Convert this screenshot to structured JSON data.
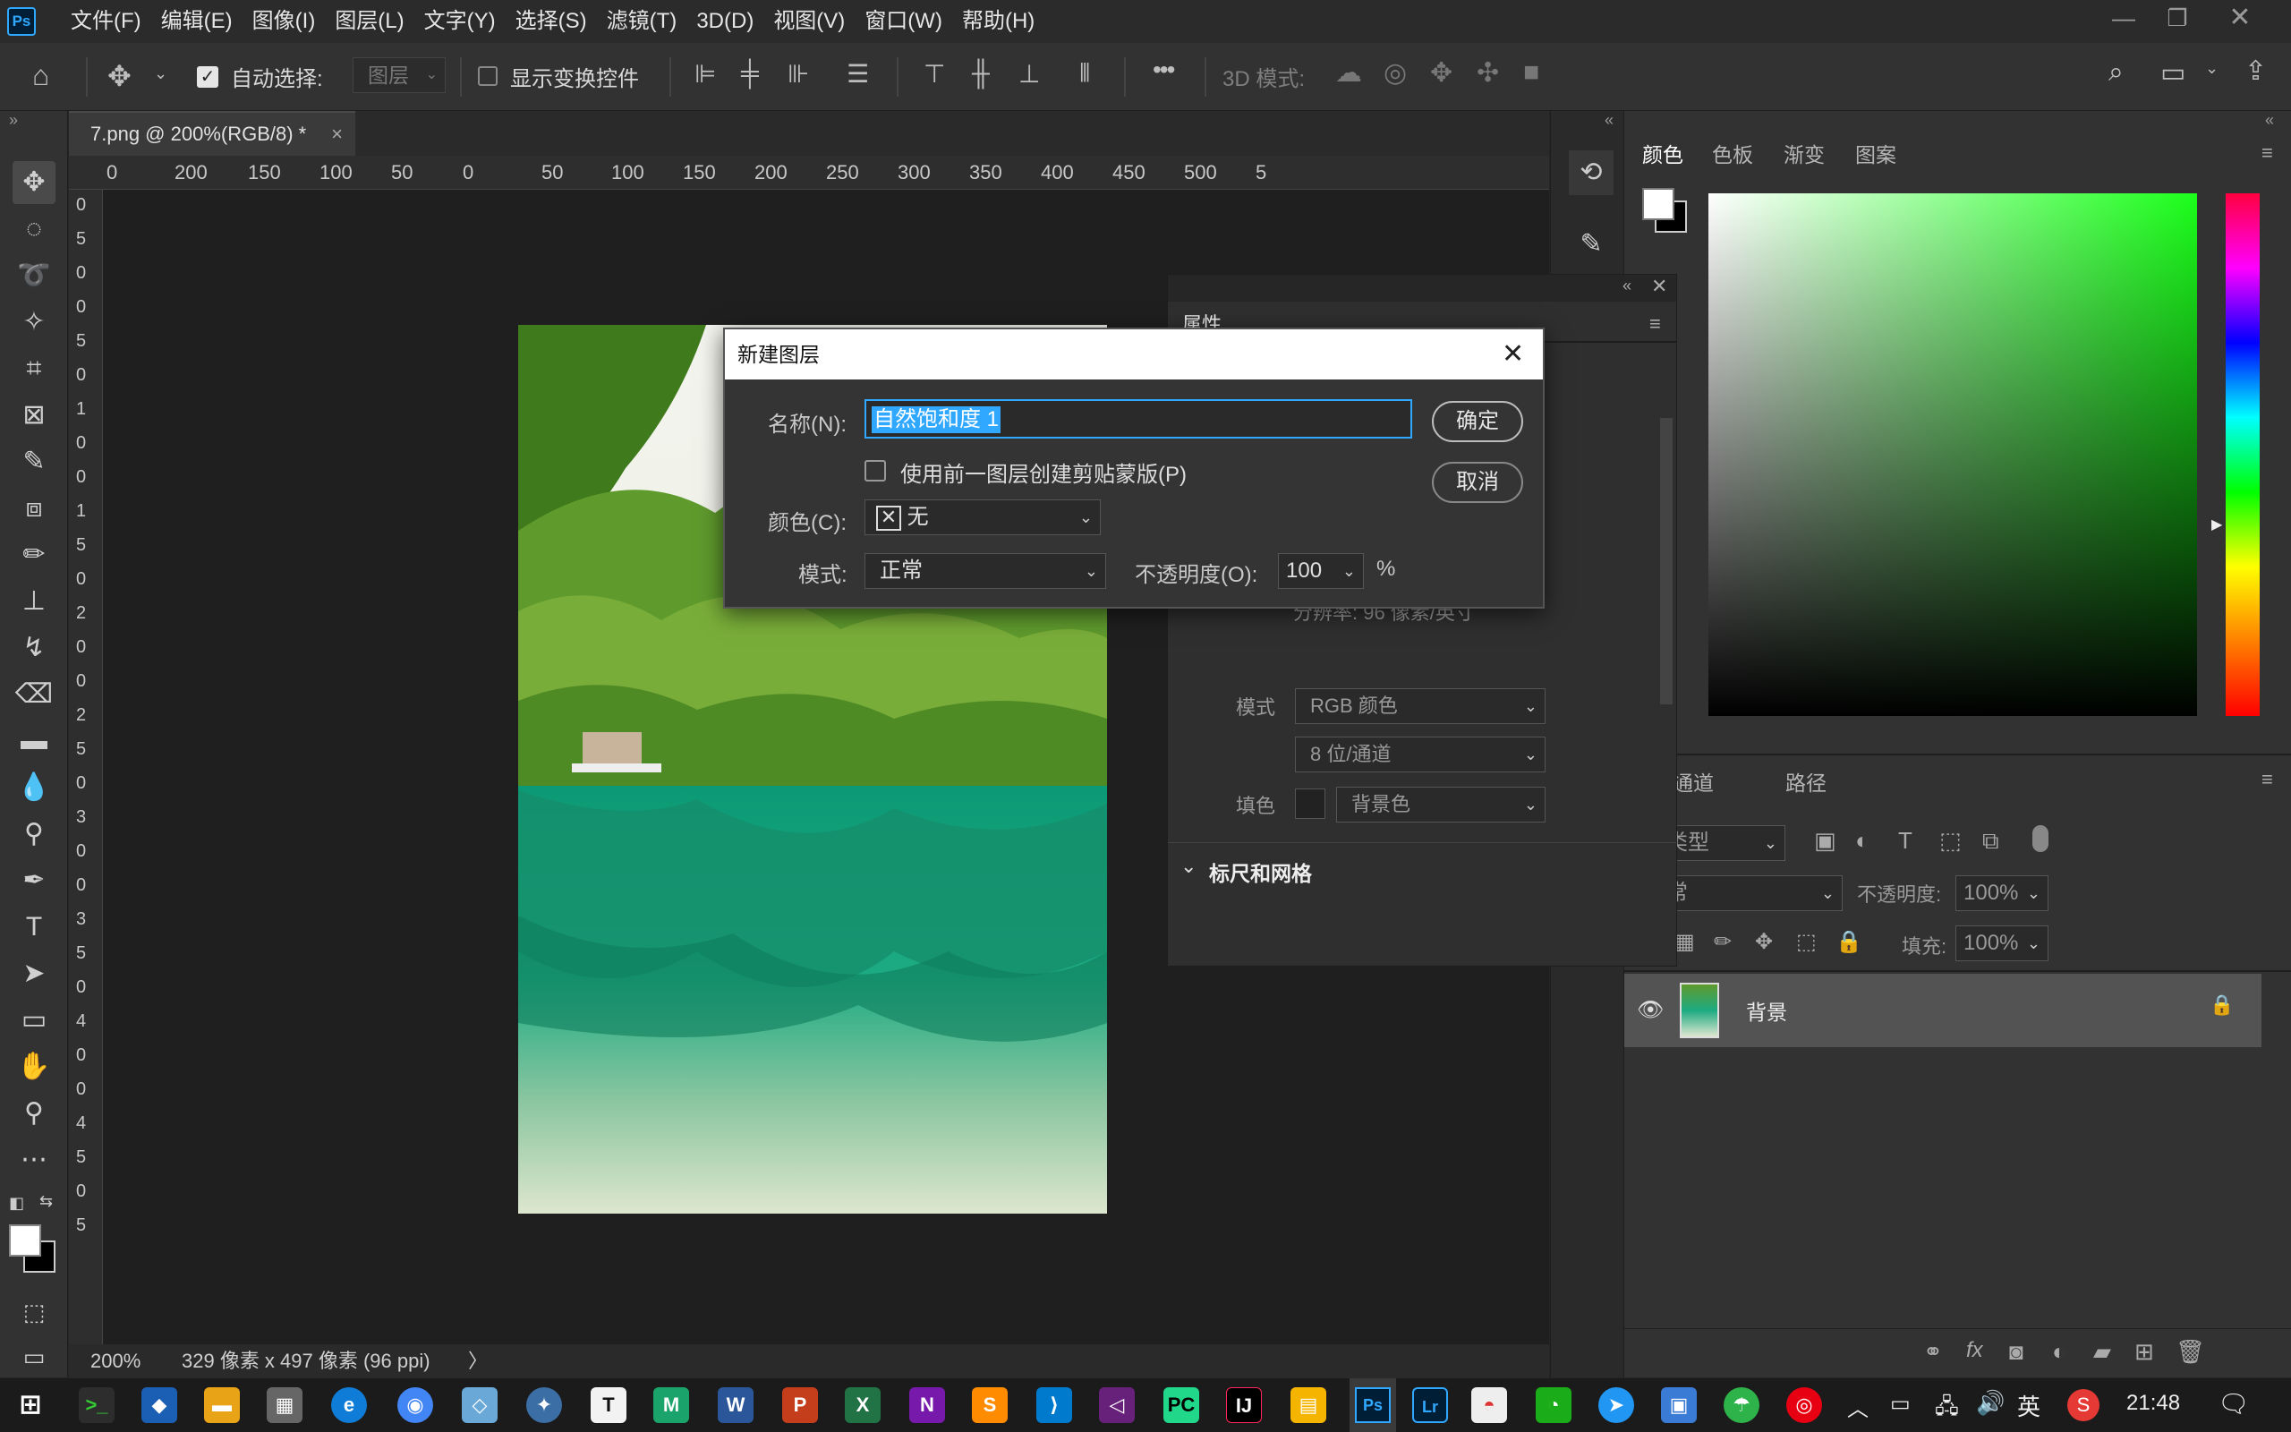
{
  "app": {
    "logo": "Ps"
  },
  "menu": [
    "文件(F)",
    "编辑(E)",
    "图像(I)",
    "图层(L)",
    "文字(Y)",
    "选择(S)",
    "滤镜(T)",
    "3D(D)",
    "视图(V)",
    "窗口(W)",
    "帮助(H)"
  ],
  "options": {
    "auto_select_label": "自动选择:",
    "auto_select_value": "图层",
    "show_transform_label": "显示变换控件",
    "mode_3d_label": "3D 模式:",
    "more": "•••"
  },
  "document": {
    "tab_title": "7.png @ 200%(RGB/8) *",
    "close": "×"
  },
  "ruler": {
    "h_labels": [
      "0",
      "200",
      "150",
      "100",
      "50",
      "0",
      "50",
      "100",
      "150",
      "200",
      "250",
      "300",
      "350",
      "400",
      "450",
      "500",
      "5"
    ],
    "v_labels": [
      "0",
      "5",
      "0",
      "0",
      "5",
      "0",
      "1",
      "0",
      "0",
      "1",
      "5",
      "0",
      "2",
      "0",
      "0",
      "2",
      "5",
      "0",
      "3",
      "0",
      "0",
      "3",
      "5",
      "0",
      "4",
      "0",
      "0",
      "4",
      "5",
      "0",
      "5"
    ]
  },
  "status": {
    "zoom": "200%",
    "info": "329 像素 x 497 像素 (96 ppi)",
    "arrow": "〉"
  },
  "color_panel": {
    "tabs": [
      "颜色",
      "色板",
      "渐变",
      "图案"
    ]
  },
  "layers_panel": {
    "tabs": [
      "通道",
      "路径"
    ],
    "filter_kind": "类型",
    "blend_mode": "常",
    "opacity_label": "不透明度:",
    "opacity_value": "100%",
    "lock_label": "锁",
    "fill_label": "填充:",
    "fill_value": "100%",
    "layer_name": "背景"
  },
  "properties": {
    "title": "属性",
    "resolution": "分辨率: 96 像素/英寸",
    "mode_label": "模式",
    "mode_value": "RGB 颜色",
    "depth_value": "8 位/通道",
    "fill_label": "填色",
    "fill_value": "背景色",
    "section": "标尺和网格"
  },
  "dialog": {
    "title": "新建图层",
    "name_label": "名称(N):",
    "name_value": "自然饱和度 1",
    "clip_label": "使用前一图层创建剪贴蒙版(P)",
    "color_label": "颜色(C):",
    "color_value": "无",
    "mode_label": "模式:",
    "mode_value": "正常",
    "opacity_label": "不透明度(O):",
    "opacity_value": "100",
    "percent": "%",
    "ok": "确定",
    "cancel": "取消"
  },
  "taskbar": {
    "ime": "英",
    "time": "21:48"
  },
  "colors": {
    "accent": "#31a8ff",
    "panel": "#323232",
    "canvas": "#1f1f1f"
  }
}
